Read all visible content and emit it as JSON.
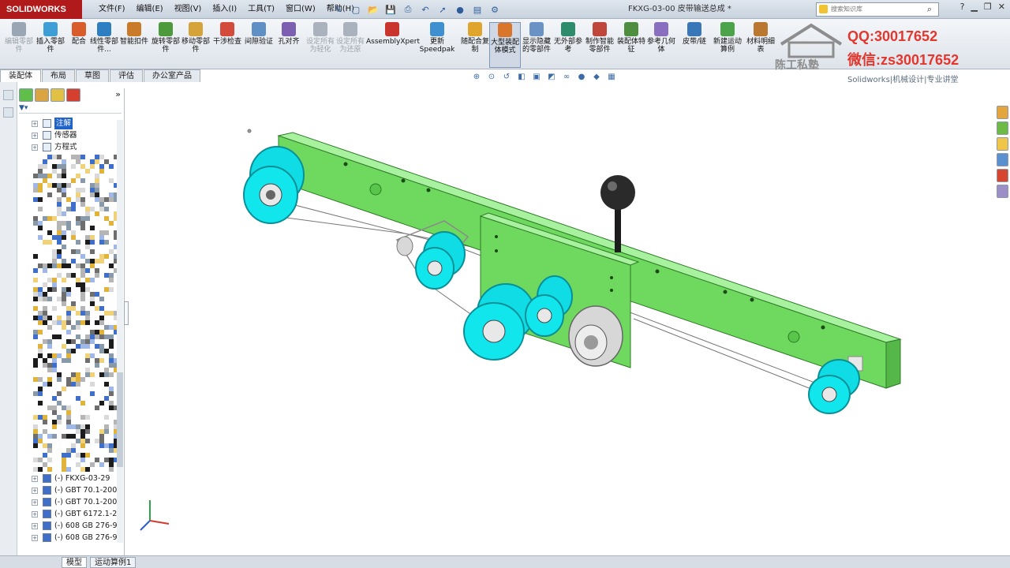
{
  "app": {
    "logo_text": "SOLIDWORKS",
    "document_title": "FKXG-03-00 皮带输送总成 *",
    "search_placeholder": "搜索知识库"
  },
  "menus": [
    "文件(F)",
    "编辑(E)",
    "视图(V)",
    "插入(I)",
    "工具(T)",
    "窗口(W)",
    "帮助(H)"
  ],
  "ribbon": {
    "buttons": [
      {
        "label": "编辑零部件",
        "state": "disabled",
        "color": "#9aa6b3"
      },
      {
        "label": "插入零部件",
        "state": "normal",
        "color": "#3d9fd6"
      },
      {
        "label": "配合",
        "state": "normal",
        "color": "#d95c2b"
      },
      {
        "label": "线性零部件...",
        "state": "normal",
        "color": "#2d7fc1"
      },
      {
        "label": "智能扣件",
        "state": "normal",
        "color": "#c97b2a"
      },
      {
        "label": "旋转零部件",
        "state": "normal",
        "color": "#4c9a3c"
      },
      {
        "label": "移动零部件",
        "state": "normal",
        "color": "#d6a23a"
      },
      {
        "label": "干涉检查",
        "state": "normal",
        "color": "#d24b3b"
      },
      {
        "label": "间隙验证",
        "state": "normal",
        "color": "#5f8fc5"
      },
      {
        "label": "孔对齐",
        "state": "normal",
        "color": "#7c5fb0"
      },
      {
        "label": "设定所有为轻化",
        "state": "disabled",
        "color": "#aab3bd"
      },
      {
        "label": "设定所有为还原",
        "state": "disabled",
        "color": "#aab3bd"
      },
      {
        "label": "AssemblyXpert",
        "state": "normal",
        "color": "#c9342d"
      },
      {
        "label": "更新Speedpak",
        "state": "normal",
        "color": "#3f8fd1"
      },
      {
        "label": "随配合复制",
        "state": "normal",
        "color": "#e0a52c"
      },
      {
        "label": "大型装配体模式",
        "state": "active",
        "color": "#d9762b"
      },
      {
        "label": "显示隐藏的零部件",
        "state": "normal",
        "color": "#6a92c4"
      },
      {
        "label": "无外部参考",
        "state": "normal",
        "color": "#2d8c6b"
      },
      {
        "label": "制作智能零部件",
        "state": "normal",
        "color": "#c0453a"
      },
      {
        "label": "装配体特征",
        "state": "normal",
        "color": "#4f8e3f"
      },
      {
        "label": "参考几何体",
        "state": "normal",
        "color": "#8a6fc0"
      },
      {
        "label": "皮带/链",
        "state": "normal",
        "color": "#3a77b8"
      },
      {
        "label": "新建运动算例",
        "state": "normal",
        "color": "#4da34a"
      },
      {
        "label": "材料明细表",
        "state": "normal",
        "color": "#b9772f"
      }
    ]
  },
  "watermark": {
    "qq": "QQ:30017652",
    "wechat": "微信:zs30017652",
    "brand": "陈工私塾",
    "subtitle": "Solidworks|机械设计|专业讲堂"
  },
  "manager_tabs": [
    "装配体",
    "布局",
    "草图",
    "评估",
    "办公室产品"
  ],
  "feature_tree": {
    "top_items": [
      {
        "label": "注解",
        "selected": true
      },
      {
        "label": "传感器",
        "selected": false
      },
      {
        "label": "方程式",
        "selected": false
      }
    ],
    "bottom_items": [
      {
        "label": "(-) FKXG-03-29"
      },
      {
        "label": "(-) GBT 70.1-200"
      },
      {
        "label": "(-) GBT 70.1-200"
      },
      {
        "label": "(-) GBT 6172.1-2"
      },
      {
        "label": "(-) 608 GB 276-9"
      },
      {
        "label": "(-) 608 GB 276-9"
      }
    ]
  },
  "bottom_tabs": [
    "模型",
    "运动算例1"
  ],
  "colors": {
    "frame_green": "#7fe07a",
    "roller_cyan": "#12e0e6",
    "handle_black": "#1c1c1c",
    "accent_red": "#e3372e"
  }
}
